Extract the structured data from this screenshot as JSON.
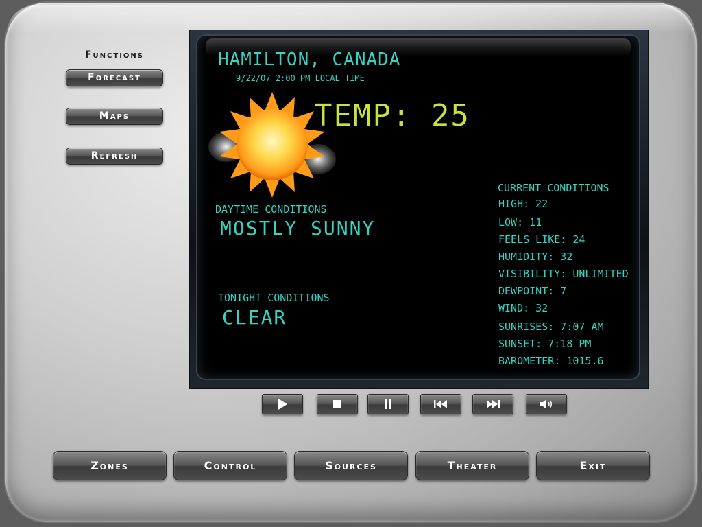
{
  "functions": {
    "title": "Functions",
    "buttons": [
      "Forecast",
      "Maps",
      "Refresh"
    ]
  },
  "weather": {
    "city": "HAMILTON, CANADA",
    "local_time": "9/22/07 2:00 PM LOCAL TIME",
    "temp": "TEMP: 25",
    "daytime_label": "DAYTIME CONDITIONS",
    "daytime_value": "MOSTLY SUNNY",
    "tonight_label": "TONIGHT CONDITIONS",
    "tonight_value": "CLEAR",
    "icon": "sun-icon",
    "current_conditions": {
      "title": "CURRENT CONDITIONS",
      "lines": [
        "HIGH: 22",
        "LOW: 11",
        "FEELS LIKE: 24",
        "HUMIDITY: 32",
        "VISIBILITY: UNLIMITED",
        "DEWPOINT: 7",
        "WIND: 32",
        "SUNRISES: 7:07 AM",
        "SUNSET: 7:18 PM",
        "BAROMETER: 1015.6"
      ]
    }
  },
  "media_controls": [
    "play-icon",
    "stop-icon",
    "pause-icon",
    "previous-icon",
    "next-icon",
    "volume-icon"
  ],
  "bottom_nav": [
    "Zones",
    "Control",
    "Sources",
    "Theater",
    "Exit"
  ],
  "colors": {
    "lcd_cyan": "#34d3c3",
    "lcd_yellow": "#c6e43c",
    "screen_bg": "#000000"
  }
}
